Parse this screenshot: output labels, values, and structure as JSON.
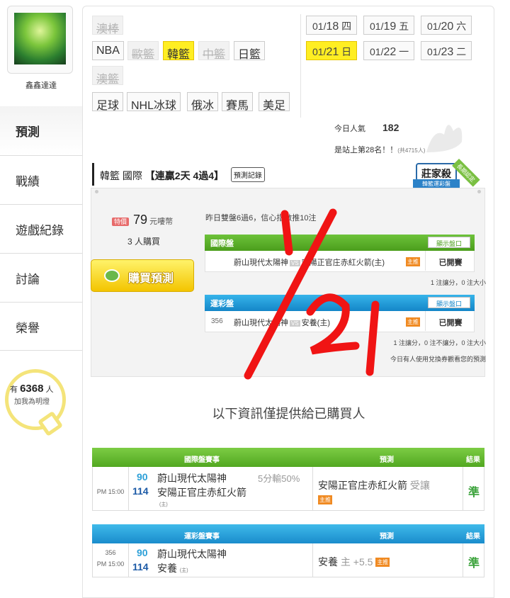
{
  "user": {
    "name": "鑫鑫達達"
  },
  "sidebar": {
    "items": [
      {
        "label": "預測",
        "active": true
      },
      {
        "label": "戰績"
      },
      {
        "label": "遊戲紀錄"
      },
      {
        "label": "討論"
      },
      {
        "label": "榮譽"
      }
    ],
    "fans": {
      "prefix": "有",
      "count": "6368",
      "suffix": "人",
      "caption": "加我為明燈"
    }
  },
  "sports": {
    "row1": [
      "澳棒"
    ],
    "row2": [
      "NBA",
      "歐籃",
      "韓籃",
      "中籃",
      "日籃"
    ],
    "row3": [
      "澳籃"
    ],
    "row4": [
      "足球",
      "NHL冰球",
      "俄冰",
      "賽馬",
      "美足"
    ],
    "selected": "韓籃"
  },
  "dates": [
    {
      "md": "01/",
      "d": "18",
      "w": "四"
    },
    {
      "md": "01/",
      "d": "19",
      "w": "五"
    },
    {
      "md": "01/",
      "d": "20",
      "w": "六"
    },
    {
      "md": "01/",
      "d": "21",
      "w": "日",
      "selected": true
    },
    {
      "md": "01/",
      "d": "22",
      "w": "一"
    },
    {
      "md": "01/",
      "d": "23",
      "w": "二"
    }
  ],
  "stats": {
    "popular_label": "今日人氣",
    "popular_value": "182",
    "rank_text": "是站上第28名！！",
    "rank_total": "(共4715人)"
  },
  "prediction": {
    "league": "韓籃 國際",
    "streak": "【連贏2天 4過4】",
    "record_btn": "預測記錄",
    "badge_main": "莊家殺手",
    "badge_sub": "韓籃運彩盤",
    "badge_ribbon": "長期認定",
    "price_tag": "特價",
    "price": "79",
    "price_unit": "元嘍幣",
    "buyers": "3 人購買",
    "buy_btn": "購買預測",
    "yesterday": "昨日雙盤6過6，信心指數推10注",
    "intl_section": "國際盤",
    "lottery_section": "運彩盤",
    "show_btn": "顯示盤口",
    "intl_match": {
      "home_away": "蔚山現代太陽神",
      "vs": "VS",
      "opponent": "安陽正官庄赤紅火箭(主)",
      "flag": "主推",
      "status": "已開賽"
    },
    "intl_summary": "1 注讓分，0 注大小",
    "lottery_match": {
      "num": "356",
      "home_away": "蔚山現代太陽神",
      "vs": "VS",
      "opponent": "安養(主)",
      "flag": "主推",
      "status": "已開賽"
    },
    "lottery_summary": "1 注讓分，0 注不讓分，0 注大小",
    "voucher_note": "今日有人使用兌換券觀看您的預測"
  },
  "info_text": "以下資訊僅提供給已購買人",
  "intl_table": {
    "h_event": "國際盤賽事",
    "h_pred": "預測",
    "h_result": "結果",
    "time": "PM 15:00",
    "away_score": "90",
    "away": "蔚山現代太陽神",
    "spread": "5分輸50%",
    "home_score": "114",
    "home": "安陽正官庄赤紅火箭",
    "home_tag": "(主)",
    "pick": "安陽正官庄赤紅火箭",
    "pick_type": "受讓",
    "pick_flag": "主推",
    "result": "準"
  },
  "lottery_table": {
    "h_event": "運彩盤賽事",
    "h_pred": "預測",
    "h_result": "結果",
    "num": "356",
    "time": "PM 15:00",
    "away_score": "90",
    "away": "蔚山現代太陽神",
    "home_score": "114",
    "home": "安養",
    "home_tag": "(主)",
    "pick": "安養",
    "pick_type": "主 +5.5",
    "pick_flag": "主推",
    "result": "準"
  },
  "overlay": {
    "text": "1/21",
    "color": "#f01414"
  }
}
